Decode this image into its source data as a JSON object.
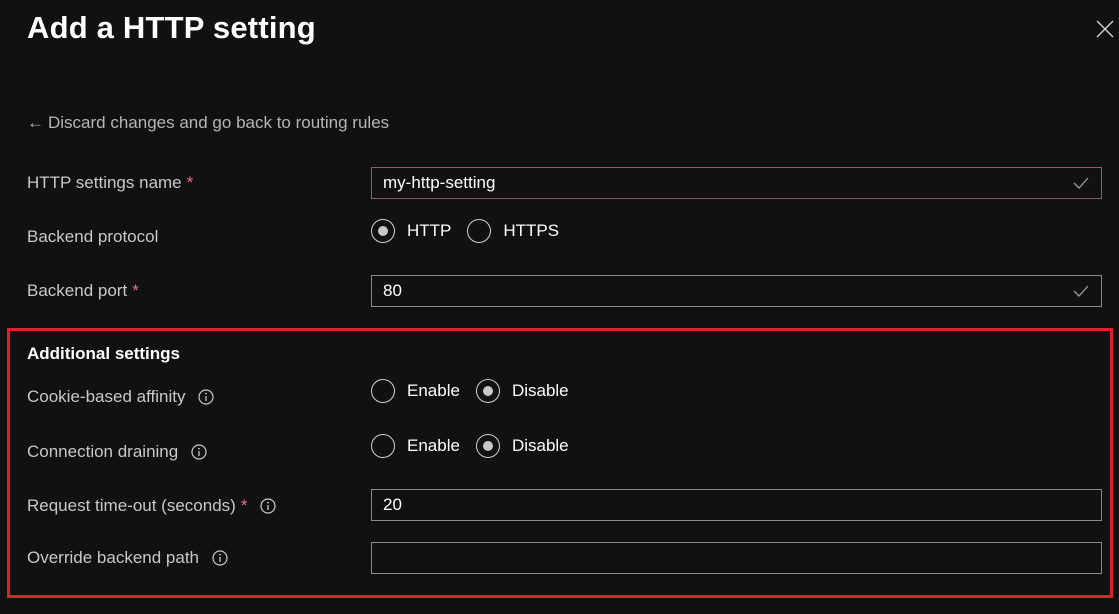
{
  "header": {
    "title": "Add a HTTP setting",
    "close_icon": "close-icon"
  },
  "back_link": {
    "arrow": "←",
    "label": "Discard changes and go back to routing rules"
  },
  "fields": {
    "settings_name": {
      "label": "HTTP settings name",
      "required": "*",
      "value": "my-http-setting"
    },
    "backend_protocol": {
      "label": "Backend protocol",
      "options": [
        "HTTP",
        "HTTPS"
      ],
      "selected": "HTTP"
    },
    "backend_port": {
      "label": "Backend port",
      "required": "*",
      "value": "80"
    }
  },
  "additional": {
    "heading": "Additional settings",
    "cookie_affinity": {
      "label": "Cookie-based affinity",
      "options": [
        "Enable",
        "Disable"
      ],
      "selected": "Disable"
    },
    "connection_draining": {
      "label": "Connection draining",
      "options": [
        "Enable",
        "Disable"
      ],
      "selected": "Disable"
    },
    "request_timeout": {
      "label": "Request time-out (seconds)",
      "required": "*",
      "value": "20"
    },
    "override_path": {
      "label": "Override backend path",
      "value": ""
    }
  },
  "colors": {
    "background": "#111111",
    "highlight": "#d9232f",
    "required": "#f1707b"
  }
}
